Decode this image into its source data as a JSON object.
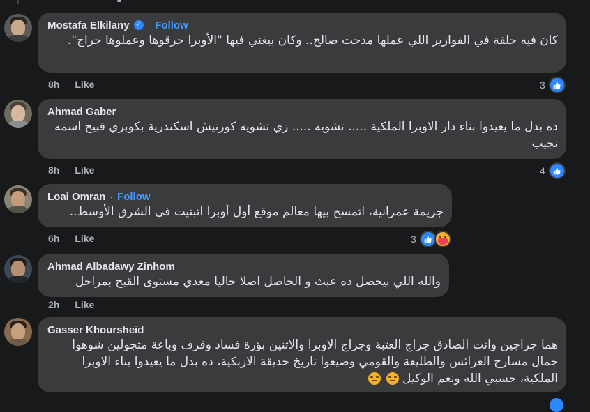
{
  "follow_label": "Follow",
  "like_label": "Like",
  "colors": {
    "accent": "#4599ff",
    "bubble": "#3a3b3c",
    "background": "#18191a"
  },
  "comments": [
    {
      "name": "Mostafa Elkilany",
      "verified": true,
      "follow": true,
      "text": "كان فيه حلقة في الفوازير اللي عملها مدحت صالح.. وكان بيغني فيها \"الأوبرا حرقوها وعملوها جراج\".",
      "time": "8h",
      "reaction_count": "3",
      "reactions": [
        "like"
      ]
    },
    {
      "name": "Ahmad Gaber",
      "verified": false,
      "follow": false,
      "text": "ده بدل ما يعيدوا بناء دار الاوبرا الملكية ..... تشويه ..... زي تشويه كورنيش اسكندرية بكوبري قبيح اسمه نجيب",
      "time": "8h",
      "reaction_count": "4",
      "reactions": [
        "like"
      ]
    },
    {
      "name": "Loai Omran",
      "verified": false,
      "follow": true,
      "text": "جريمة عمرانية، اتمسح بيها معالم موقع أول أوبرا اتبنيت في الشرق الأوسط..",
      "time": "6h",
      "reaction_count": "3",
      "reactions": [
        "like",
        "care"
      ]
    },
    {
      "name": "Ahmad Albadawy Zinhom",
      "verified": false,
      "follow": false,
      "text": "والله اللي بيحصل ده عبث و الحاصل اصلا حاليا معدي مستوى القبح بمراحل",
      "time": "2h",
      "reaction_count": "",
      "reactions": []
    },
    {
      "name": "Gasser Khoursheid",
      "verified": false,
      "follow": false,
      "text": "هما جراجين وانت الصادق جراج العتبة وجراج الاوبرا والاتنين بؤرة فساد وقرف وباعة متجولين شوهوا جمال مسارح العرائس والطليعة والقومي وضيعوا تاريخ حديقة الازبكية، ده بدل ما يعيدوا بناء الاوبرا الملكية، حسبي الله ونعم الوكيل",
      "time": "",
      "reaction_count": "",
      "reactions": []
    }
  ]
}
